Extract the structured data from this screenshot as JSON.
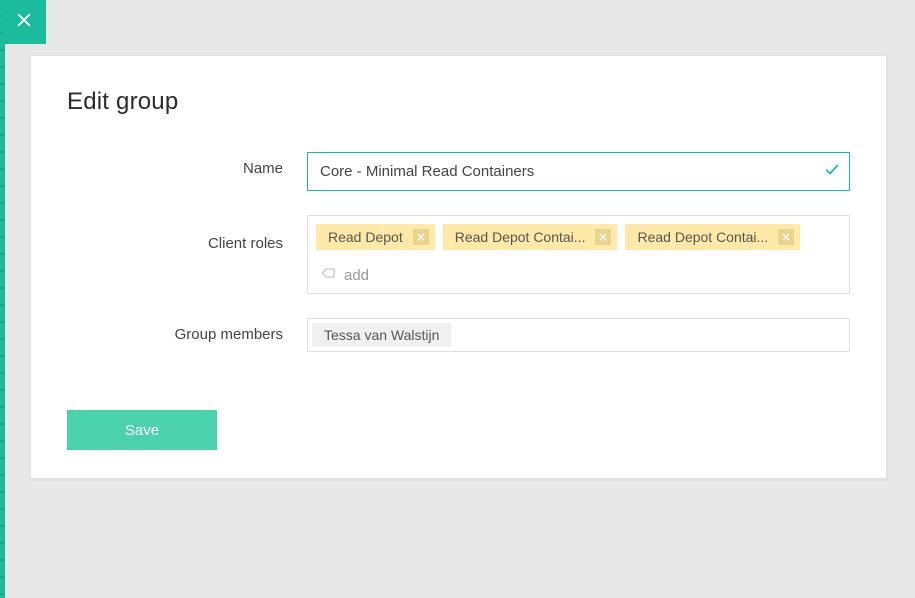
{
  "title": "Edit group",
  "labels": {
    "name": "Name",
    "clientRoles": "Client roles",
    "groupMembers": "Group members"
  },
  "name": {
    "value": "Core - Minimal Read Containers"
  },
  "roles": [
    {
      "label": "Read Depot"
    },
    {
      "label": "Read Depot Contai..."
    },
    {
      "label": "Read Depot Contai..."
    }
  ],
  "addPlaceholder": "add",
  "members": [
    {
      "name": "Tessa van Walstijn"
    }
  ],
  "buttons": {
    "save": "Save"
  }
}
